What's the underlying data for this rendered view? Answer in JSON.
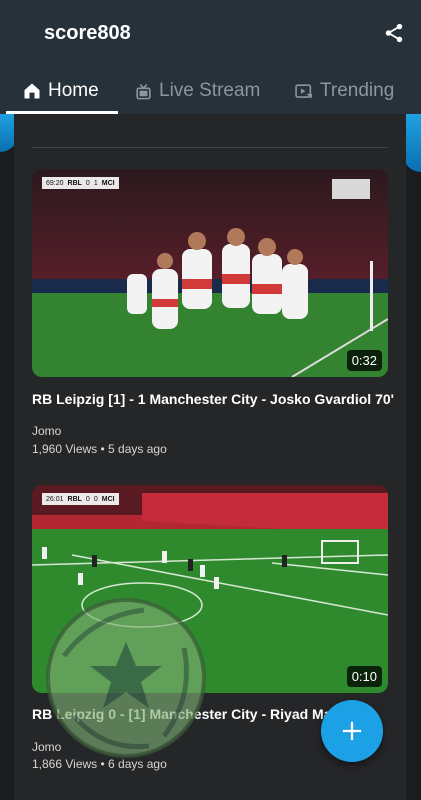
{
  "app": {
    "title": "score808"
  },
  "tabs": [
    {
      "label": "Home",
      "icon": "home-icon"
    },
    {
      "label": "Live Stream",
      "icon": "live-stream-icon"
    },
    {
      "label": "Trending",
      "icon": "trending-icon"
    }
  ],
  "videos": [
    {
      "title": "RB Leipzig [1] - 1 Manchester City - Josko Gvardiol 70'",
      "author": "Jomo",
      "views": "1,960 Views",
      "age": "5 days ago",
      "duration": "0:32",
      "score_bug": {
        "time": "69:20",
        "home": "RBL",
        "home_score": "0",
        "away_score": "1",
        "away": "MCI"
      }
    },
    {
      "title": "RB Leipzig 0 - [1] Manchester City - Riyad Mahrez",
      "author": "Jomo",
      "views": "1,866 Views",
      "age": "6 days ago",
      "duration": "0:10",
      "score_bug": {
        "time": "26:01",
        "home": "RBL",
        "home_score": "0",
        "away_score": "0",
        "away": "MCI"
      }
    }
  ],
  "separator": "•",
  "colors": {
    "appbar": "#263139",
    "accent": "#1da1e6",
    "background": "#1b1c1e",
    "card": "#252628"
  }
}
